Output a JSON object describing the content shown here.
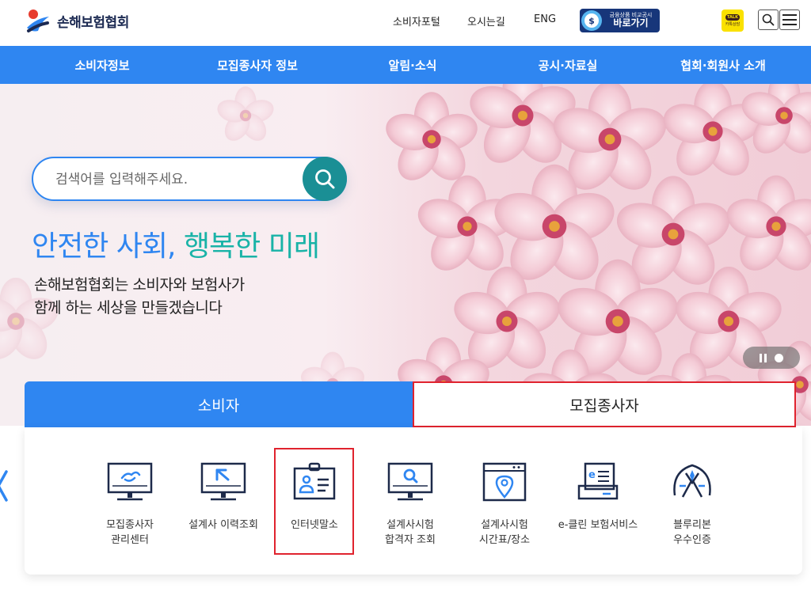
{
  "header": {
    "logo_text": "손해보험협회",
    "util_links": [
      "소비자포털",
      "오시는길",
      "ENG"
    ],
    "compare_button": {
      "small": "금융상품 비교공시",
      "big": "바로가기"
    },
    "kakao": {
      "bubble": "TALK",
      "label": "카톡상담"
    }
  },
  "gnb": [
    "소비자정보",
    "모집종사자 정보",
    "알림·소식",
    "공시·자료실",
    "협회·회원사 소개"
  ],
  "hero": {
    "search_placeholder": "검색어를 입력해주세요.",
    "title_part1": "안전한 사회, ",
    "title_part2": "행복한 미래",
    "subtitle_line1": "손해보험협회는 소비자와 보험사가",
    "subtitle_line2": "함께 하는 세상을 만들겠습니다"
  },
  "tabs": {
    "consumer": "소비자",
    "agent": "모집종사자"
  },
  "quick_items": [
    {
      "label": "모집종사자\n관리센터",
      "icon": "monitor-handshake-icon"
    },
    {
      "label": "설계사 이력조회",
      "icon": "monitor-cursor-icon"
    },
    {
      "label": "인터넷말소",
      "icon": "id-card-icon"
    },
    {
      "label": "설계사시험\n합격자 조회",
      "icon": "monitor-search-icon"
    },
    {
      "label": "설계사시험\n시간표/장소",
      "icon": "browser-location-icon"
    },
    {
      "label": "e-클린 보험서비스",
      "icon": "e-document-icon"
    },
    {
      "label": "블루리본\n우수인증",
      "icon": "blue-ribbon-icon"
    }
  ],
  "colors": {
    "primary": "#2f86f1",
    "teal": "#19b3a7",
    "highlight": "#e0232e",
    "navy": "#17367a"
  }
}
